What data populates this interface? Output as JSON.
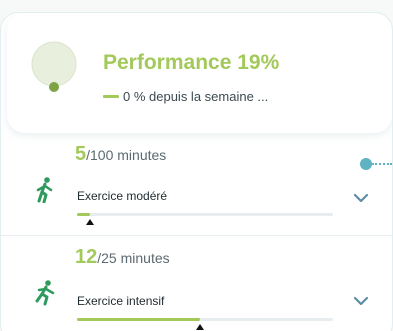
{
  "performance": {
    "title": "Performance 19%",
    "subtitle": "0 % depuis la semaine ...",
    "icon": "location-pin-icon"
  },
  "exercises": [
    {
      "value": "5",
      "suffix": "/100 minutes",
      "label": "Exercice modéré",
      "progress": 0.05,
      "icon": "walking-icon"
    },
    {
      "value": "12",
      "suffix": "/25 minutes",
      "label": "Exercice intensif",
      "progress": 0.48,
      "icon": "running-icon"
    }
  ],
  "colors": {
    "accent": "#a3c95a",
    "icon_green": "#2e9a5e",
    "pin_dark": "#7fa245",
    "pin_light": "#e8f0dd",
    "tour_dot": "#5fb2c2",
    "chevron": "#5e8da3"
  }
}
